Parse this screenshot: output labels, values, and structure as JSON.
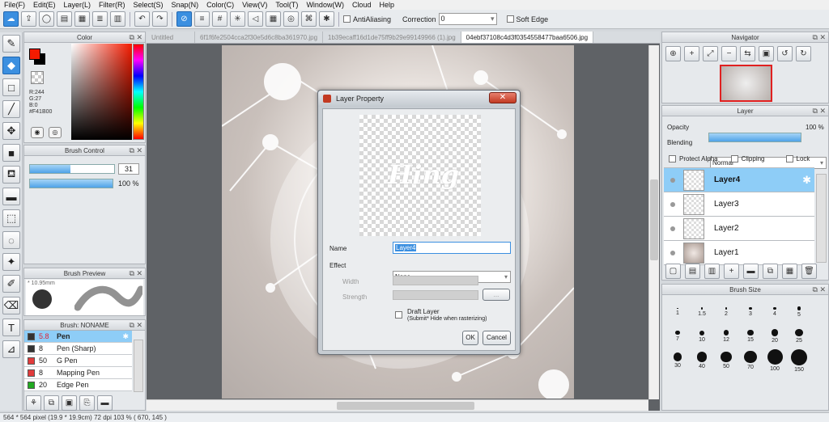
{
  "menu": [
    "File(F)",
    "Edit(E)",
    "Layer(L)",
    "Filter(R)",
    "Select(S)",
    "Snap(N)",
    "Color(C)",
    "View(V)",
    "Tool(T)",
    "Window(W)",
    "Cloud",
    "Help"
  ],
  "toolbar": {
    "antialiasing_label": "AntiAliasing",
    "correction_label": "Correction",
    "correction_value": "0",
    "soft_edge_label": "Soft Edge"
  },
  "color_panel": {
    "title": "Color",
    "r": "R:244",
    "g": "G:27",
    "b": "B:0",
    "hex": "#F41B00",
    "fg_color": "#f41b00",
    "bg_color": "#000000"
  },
  "brush_control": {
    "title": "Brush Control",
    "size_value": "31",
    "opacity_value": "100 %",
    "size_fraction": 0.48,
    "opacity_fraction": 1.0
  },
  "brush_preview": {
    "title": "Brush Preview",
    "size_label": "* 10.95mm"
  },
  "brush_list": {
    "title": "Brush: NONAME",
    "items": [
      {
        "size": "5.8",
        "name": "Pen",
        "swatch": "#333333",
        "selected": true
      },
      {
        "size": "8",
        "name": "Pen (Sharp)",
        "swatch": "#333333",
        "selected": false
      },
      {
        "size": "50",
        "name": "G Pen",
        "swatch": "#e23b3b",
        "selected": false
      },
      {
        "size": "8",
        "name": "Mapping Pen",
        "swatch": "#e23b3b",
        "selected": false
      },
      {
        "size": "20",
        "name": "Edge Pen",
        "swatch": "#22aa22",
        "selected": false
      }
    ]
  },
  "tabs": [
    "Untitled",
    "6f1f6fe2504cca2f30e5d6c8ba361970.jpg",
    "1b39ecaff16d1de75ff9b29e99149966 (1).jpg",
    "04ebf37108c4d3f0354558477baa6506.jpg"
  ],
  "navigator": {
    "title": "Navigator"
  },
  "layer_panel": {
    "title": "Layer",
    "opacity_label": "Opacity",
    "opacity_value": "100 %",
    "opacity_fraction": 1.0,
    "blending_label": "Blending",
    "blending_value": "Normal",
    "protect_alpha": "Protect Alpha",
    "clipping": "Clipping",
    "lock": "Lock",
    "layers": [
      {
        "name": "Layer4",
        "selected": true
      },
      {
        "name": "Layer3",
        "selected": false
      },
      {
        "name": "Layer2",
        "selected": false
      },
      {
        "name": "Layer1",
        "selected": false
      }
    ]
  },
  "brush_size": {
    "title": "Brush Size",
    "sizes": [
      "1",
      "1.5",
      "2",
      "3",
      "4",
      "5",
      "7",
      "10",
      "12",
      "15",
      "20",
      "25",
      "30",
      "40",
      "50",
      "70",
      "100",
      "150"
    ]
  },
  "status": {
    "text": "564 * 564 pixel   (19.9 * 19.9cm)   72 dpi   103 %   ( 670, 145 )"
  },
  "dialog": {
    "title": "Layer Property",
    "preview_text": "Hing",
    "name_label": "Name",
    "name_value": "Layer4",
    "effect_label": "Effect",
    "effect_value": "None",
    "width_label": "Width",
    "strength_label": "Strength",
    "strength_btn": "...",
    "draft_label": "Draft Layer",
    "draft_sub": "(Submit* Hide when rasterizing)",
    "ok": "OK",
    "cancel": "Cancel"
  }
}
